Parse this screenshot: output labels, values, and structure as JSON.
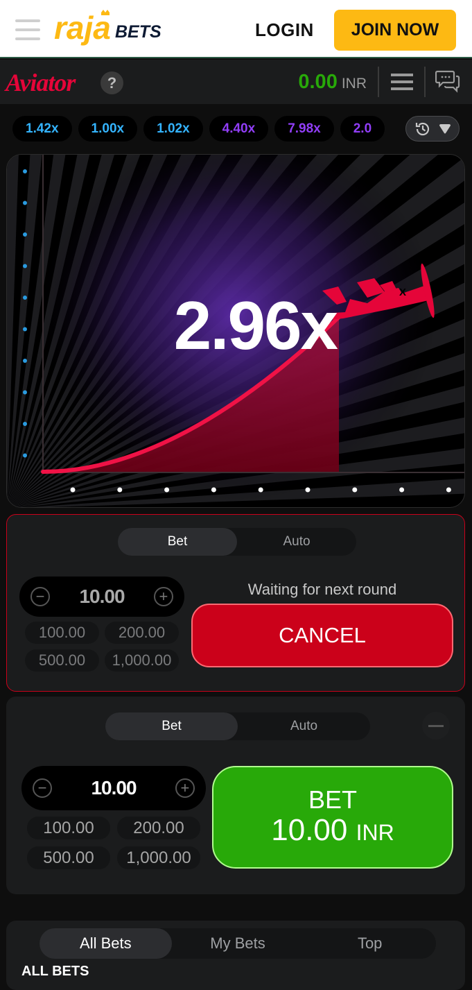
{
  "site": {
    "brand": "rajabets",
    "brand_part1": "raja",
    "brand_part2": "BETS",
    "login_label": "LOGIN",
    "join_label": "JOIN NOW",
    "colors": {
      "brand_yellow": "#fdb913",
      "brand_navy": "#0d1a33"
    }
  },
  "game": {
    "title": "Aviator",
    "help_label": "?",
    "balance": "0.00",
    "currency": "INR",
    "colors": {
      "aviator_red": "#e50539",
      "balance_green": "#28a909"
    }
  },
  "history": {
    "items": [
      {
        "value": "1.42x",
        "color": "#34b4ff"
      },
      {
        "value": "1.00x",
        "color": "#34b4ff"
      },
      {
        "value": "1.02x",
        "color": "#34b4ff"
      },
      {
        "value": "4.40x",
        "color": "#913ef8"
      },
      {
        "value": "7.98x",
        "color": "#913ef8"
      },
      {
        "value": "2.0",
        "color": "#913ef8"
      }
    ]
  },
  "round": {
    "multiplier": "2.96x",
    "progress_fraction": 0.7
  },
  "bet_panel_1": {
    "tabs": [
      "Bet",
      "Auto"
    ],
    "active_tab": "Bet",
    "amount": "10.00",
    "quick_amounts": [
      "100.00",
      "200.00",
      "500.00",
      "1,000.00"
    ],
    "status_text": "Waiting for next round",
    "action_label": "CANCEL"
  },
  "bet_panel_2": {
    "tabs": [
      "Bet",
      "Auto"
    ],
    "active_tab": "Bet",
    "amount": "10.00",
    "quick_amounts": [
      "100.00",
      "200.00",
      "500.00",
      "1,000.00"
    ],
    "action_line1": "BET",
    "action_amount": "10.00",
    "action_currency": "INR"
  },
  "bets_list": {
    "tabs": [
      "All Bets",
      "My Bets",
      "Top"
    ],
    "active_tab": "All Bets",
    "section_title": "ALL BETS"
  }
}
